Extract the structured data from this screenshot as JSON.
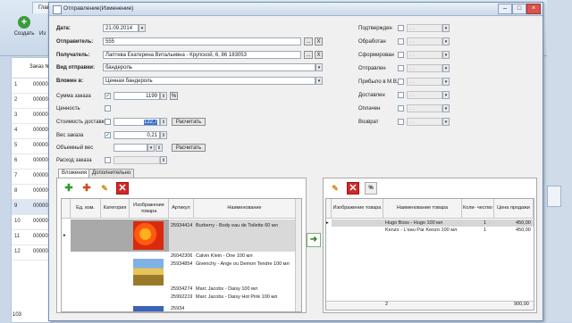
{
  "background": {
    "tab_label": "Глав",
    "create_label": "Создать",
    "edit_label_partial": "Из",
    "grid_header": "Заказ №",
    "rows": [
      {
        "n": "1",
        "v": "00000"
      },
      {
        "n": "2",
        "v": "00000"
      },
      {
        "n": "3",
        "v": "00000"
      },
      {
        "n": "4",
        "v": "00000"
      },
      {
        "n": "5",
        "v": "00000"
      },
      {
        "n": "6",
        "v": "00000"
      },
      {
        "n": "7",
        "v": "00000"
      },
      {
        "n": "8",
        "v": "00000"
      },
      {
        "n": "9",
        "v": "00000"
      },
      {
        "n": "10",
        "v": "00000"
      },
      {
        "n": "11",
        "v": "00000"
      },
      {
        "n": "12",
        "v": "00000"
      }
    ],
    "status_count": "103"
  },
  "dialog": {
    "title": "Отправление(Изменение)",
    "date_label": "Дата:",
    "date_value": "21.09.2014",
    "sender_label": "Отправитель:",
    "sender_value": "555",
    "sender_btn": "...",
    "sender_clear": "X",
    "recipient_label": "Получатель:",
    "recipient_value": "Лаптева Екатерина Витальевна - Крупской, 6, 86 183053",
    "recipient_btn": "...",
    "recipient_clear": "X",
    "shipment_type_label": "Вид отправки:",
    "shipment_type_value": "бандероль",
    "attachment_label": "Вложен в:",
    "attachment_value": "Ценная бандероль",
    "order_sum_label": "Сумма заказа",
    "order_sum_value": "1199",
    "percent_btn": "%",
    "value_label": "Ценность",
    "delivery_cost_label": "Стоимость доставки",
    "delivery_cost_value": "122,7",
    "calc_btn_1": "Расчитать",
    "weight_label": "Вес заказа",
    "weight_value": "0,21",
    "volume_weight_label": "Объемный вес",
    "calc_btn_2": "Расчитать",
    "order_expense_label": "Расход заказа",
    "statuses": [
      {
        "label": "Подтвержден"
      },
      {
        "label": "Обработан"
      },
      {
        "label": "Сформирован"
      },
      {
        "label": "Отправлен"
      },
      {
        "label": "Прибыло в М.В."
      },
      {
        "label": "Доставлен"
      },
      {
        "label": "Оплачен"
      },
      {
        "label": "Возврат"
      }
    ],
    "status_date_placeholder": ". .",
    "tabs": [
      "Вложения",
      "Дополнительно"
    ],
    "left_grid": {
      "headers": [
        "Ед. изм.",
        "Категория",
        "Изображение товара",
        "Артикул",
        "Наименование"
      ],
      "rows": [
        {
          "article": "25934414",
          "name": "Burberry - Body eau de Toilette 60 мл"
        },
        {
          "article": "26042306",
          "name": "Calvin Klein - One 100 мл"
        },
        {
          "article": "25934854",
          "name": "Givenchy - Ange ou Demon Tendre 100 мл"
        },
        {
          "article": "25934274",
          "name": "Marc Jacobs - Daisy 100 мл"
        },
        {
          "article": "25992219",
          "name": "Marc Jacobs - Daisy Hot Pink 100 мл"
        },
        {
          "article": "25934",
          "name": ""
        }
      ]
    },
    "right_grid": {
      "headers": [
        "Изображение товара",
        "Наименование товара",
        "Коли- чество",
        "Цена продажи"
      ],
      "rows": [
        {
          "name": "Hugo Boss - Hugo 100 мл",
          "qty": "1",
          "price": "450,00"
        },
        {
          "name": "Kenzo - L'eau Par Kenzo 100 мл",
          "qty": "1",
          "price": "450,00"
        }
      ],
      "footer": {
        "qty": "2",
        "price": "900,00"
      }
    },
    "percent_btn_2": "%"
  }
}
